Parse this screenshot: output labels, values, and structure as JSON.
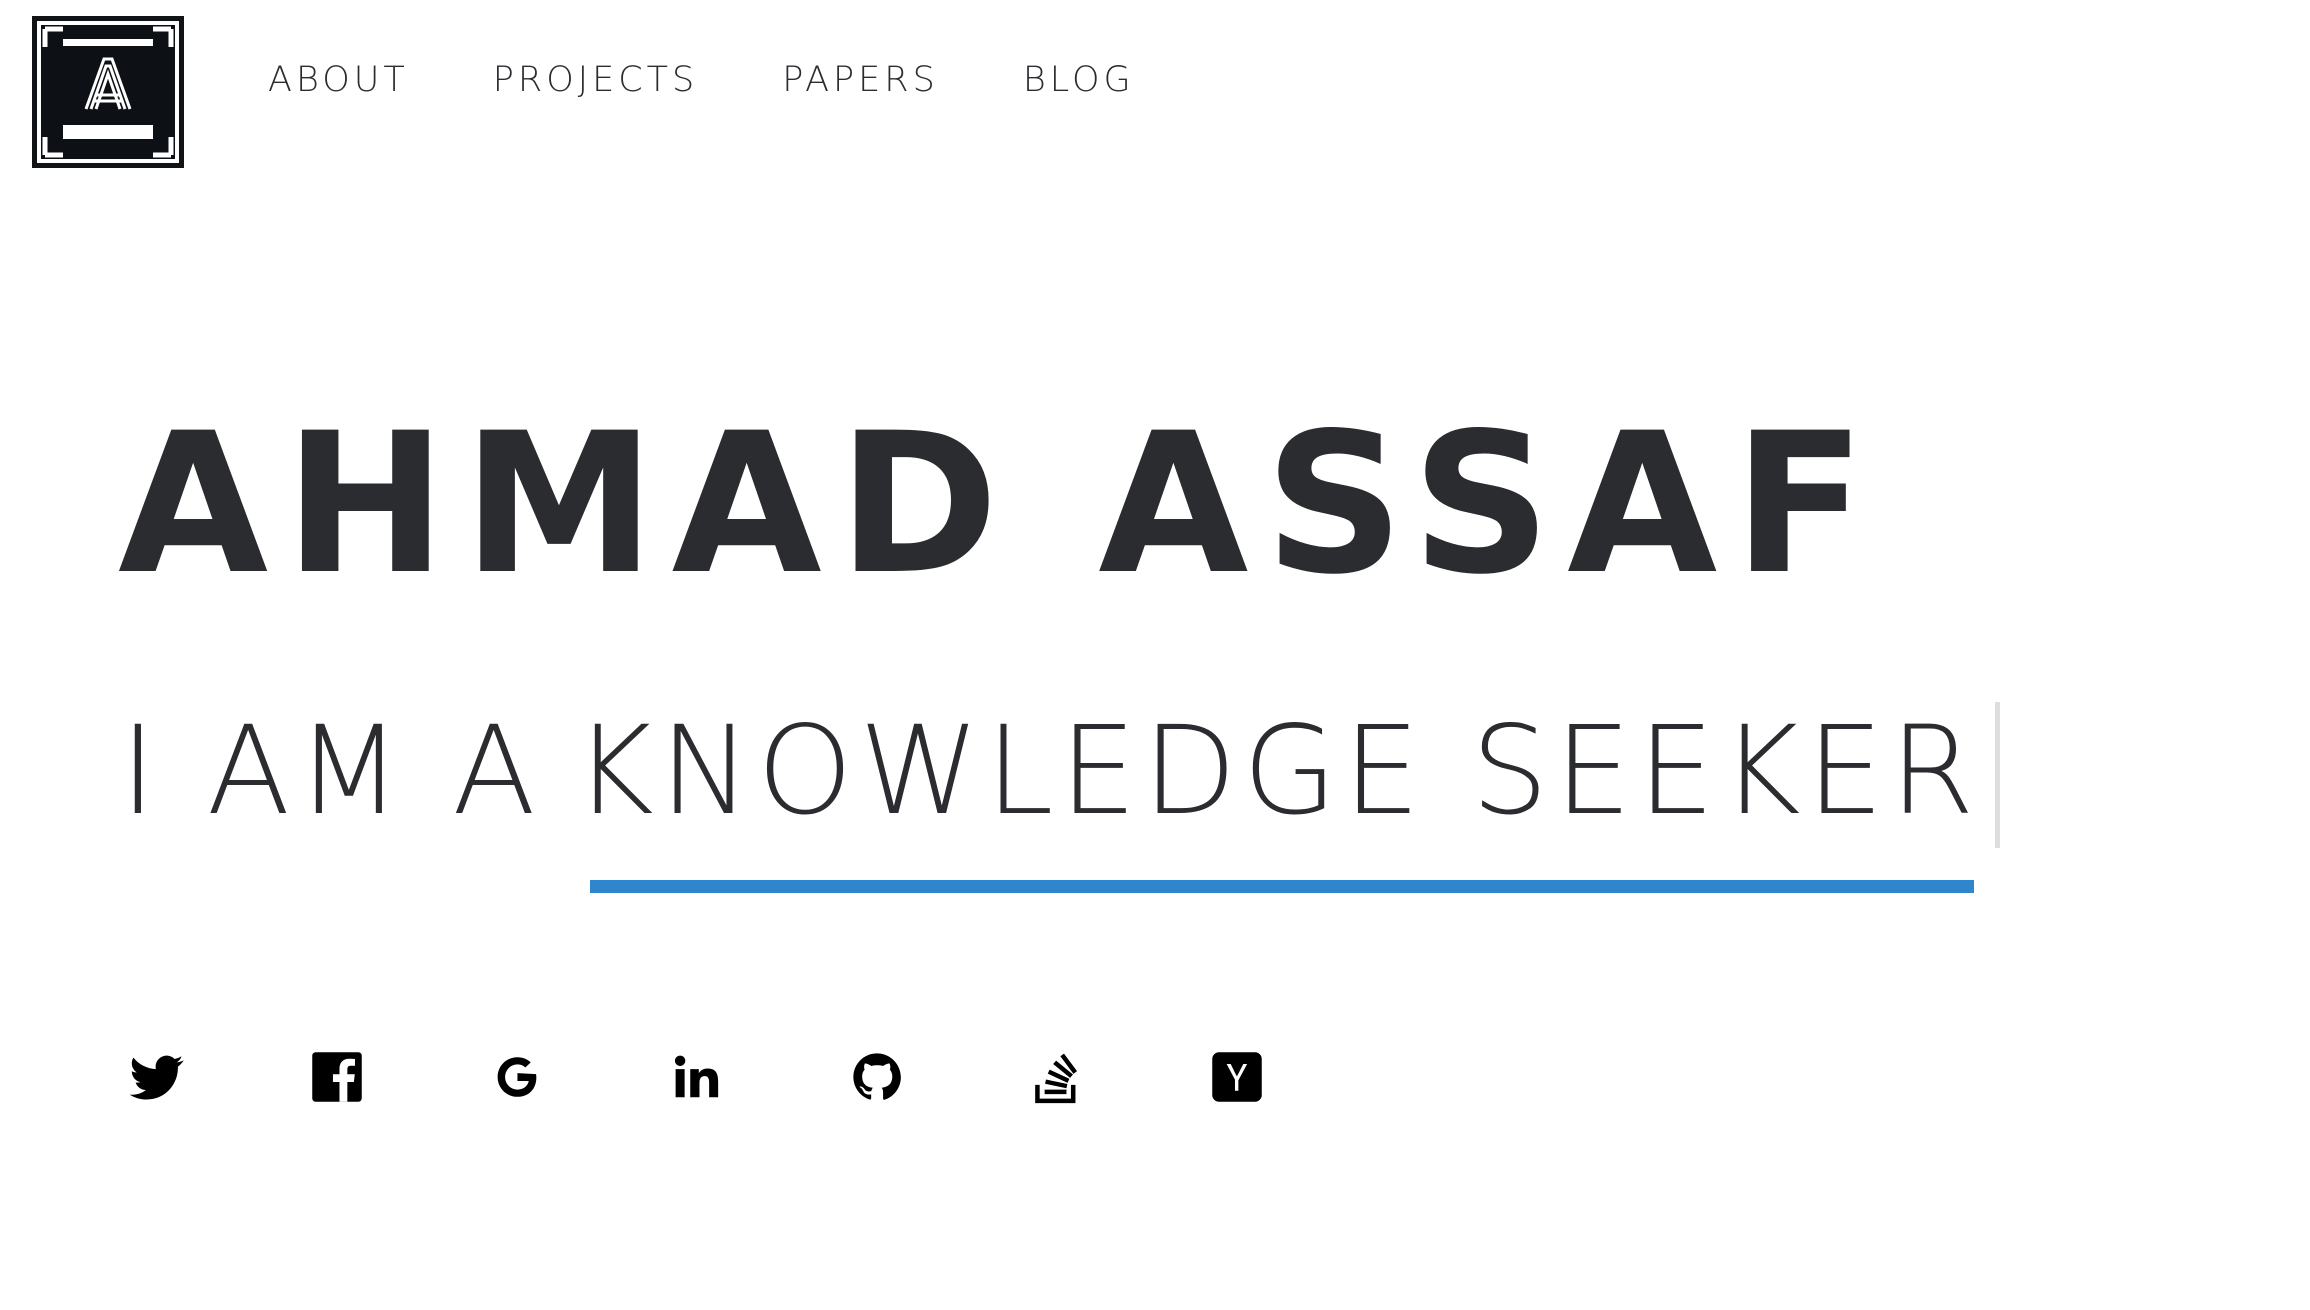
{
  "logo": {
    "letter": "A",
    "icon": "logo-a-icon"
  },
  "nav": {
    "items": [
      {
        "label": "ABOUT"
      },
      {
        "label": "PROJECTS"
      },
      {
        "label": "PAPERS"
      },
      {
        "label": "BLOG"
      }
    ]
  },
  "hero": {
    "name": "AHMAD ASSAF",
    "tagline_prefix": "I AM A",
    "tagline_word": "KNOWLEDGE SEEKER"
  },
  "colors": {
    "text": "#2b2c30",
    "accent": "#2f86cc",
    "logo_bg": "#0d1116"
  },
  "social": {
    "items": [
      {
        "icon": "twitter-icon"
      },
      {
        "icon": "facebook-icon"
      },
      {
        "icon": "google-icon"
      },
      {
        "icon": "linkedin-icon"
      },
      {
        "icon": "github-icon"
      },
      {
        "icon": "stackoverflow-icon"
      },
      {
        "icon": "hackernews-icon"
      }
    ]
  }
}
